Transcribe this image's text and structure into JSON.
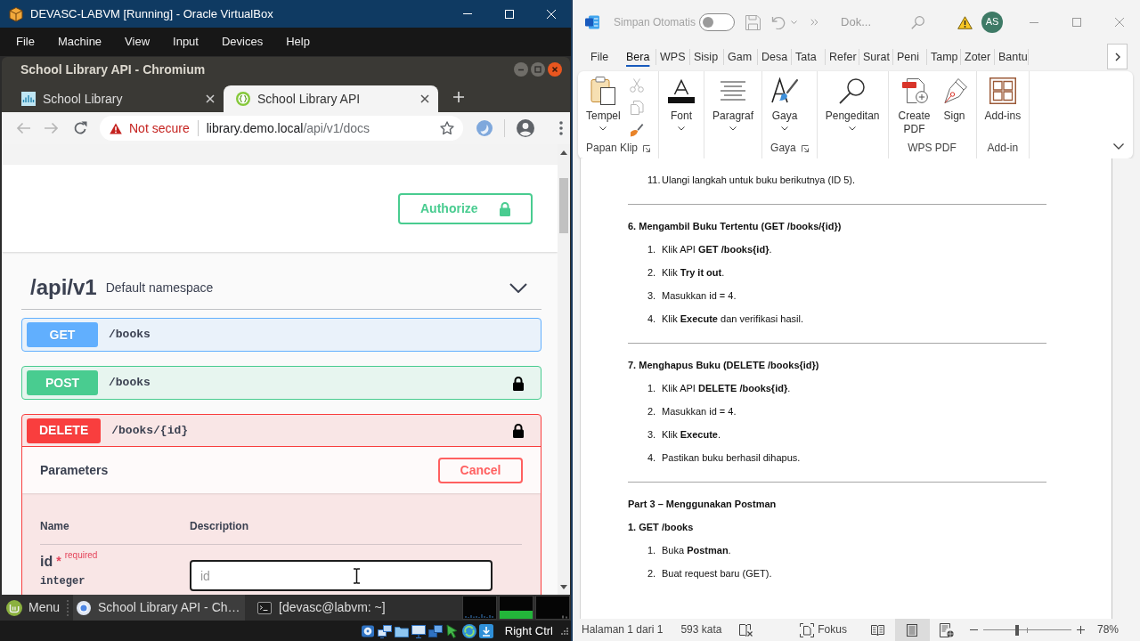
{
  "virtualbox": {
    "title": "DEVASC-LABVM [Running] - Oracle VirtualBox",
    "menu": [
      "File",
      "Machine",
      "View",
      "Input",
      "Devices",
      "Help"
    ],
    "browser": {
      "title": "School Library API - Chromium",
      "tabs": [
        {
          "label": "School Library",
          "selected": false
        },
        {
          "label": "School Library API",
          "selected": true
        }
      ],
      "address": {
        "security": "Not secure",
        "host": "library.demo.local",
        "path": "/api/v1/docs"
      },
      "swagger": {
        "authorize": "Authorize",
        "namespace": {
          "name": "/api/v1",
          "description": "Default namespace",
          "expanded": true
        },
        "operations": [
          {
            "method": "GET",
            "path": "/books",
            "color": "#61affe",
            "locked": false,
            "expanded": false
          },
          {
            "method": "POST",
            "path": "/books",
            "color": "#49cc90",
            "locked": true,
            "expanded": false
          },
          {
            "method": "DELETE",
            "path": "/books/{id}",
            "color": "#f93e3e",
            "locked": true,
            "expanded": true,
            "parameters": {
              "title": "Parameters",
              "cancel": "Cancel",
              "columns": [
                "Name",
                "Description"
              ],
              "rows": [
                {
                  "name": "id",
                  "required_mark": "*",
                  "required_text": "required",
                  "type": "integer",
                  "placeholder": "id"
                }
              ]
            }
          }
        ]
      }
    },
    "taskbar": {
      "menu": "Menu",
      "tasks": [
        {
          "kind": "browser",
          "label": "School Library API - Ch…",
          "selected": true
        },
        {
          "kind": "terminal",
          "label": "[devasc@labvm: ~]",
          "selected": false
        }
      ]
    },
    "status_bar": {
      "host_key": "Right Ctrl"
    }
  },
  "word": {
    "autosave": {
      "label": "Simpan Otomatis",
      "on": false
    },
    "doc_title": "Dok...",
    "user_initials": "AS",
    "tabs": [
      {
        "label": "File",
        "selected": false
      },
      {
        "label": "Bera",
        "selected": true
      },
      {
        "label": "WPS",
        "selected": false
      },
      {
        "label": "Sisip",
        "selected": false
      },
      {
        "label": "Gam",
        "selected": false
      },
      {
        "label": "Desa",
        "selected": false
      },
      {
        "label": "Tata",
        "selected": false
      },
      {
        "label": "Refer",
        "selected": false
      },
      {
        "label": "Surat",
        "selected": false
      },
      {
        "label": "Peni",
        "selected": false
      },
      {
        "label": "Tamp",
        "selected": false
      },
      {
        "label": "Zoter",
        "selected": false
      },
      {
        "label": "Bantu",
        "selected": false
      }
    ],
    "ribbon_groups": [
      {
        "label": "Papan Klip",
        "launcher": true,
        "commands": [
          {
            "kind": "paste",
            "label": "Tempel",
            "dropdown": true
          },
          {
            "kind": "cut",
            "disabled": true
          },
          {
            "kind": "copy",
            "disabled": true
          },
          {
            "kind": "format_painter",
            "disabled": false
          }
        ]
      },
      {
        "commands": [
          {
            "kind": "font",
            "label": "Font",
            "dropdown": true
          }
        ]
      },
      {
        "commands": [
          {
            "kind": "paragraph",
            "label": "Paragraf",
            "dropdown": true
          }
        ]
      },
      {
        "label": "Gaya",
        "launcher": true,
        "commands": [
          {
            "kind": "styles",
            "label": "Gaya",
            "dropdown": true
          }
        ]
      },
      {
        "commands": [
          {
            "kind": "editing",
            "label": "Pengeditan",
            "dropdown": true
          }
        ]
      },
      {
        "label": "WPS PDF",
        "commands": [
          {
            "kind": "create_pdf",
            "label": "Create PDF",
            "dropdown": false
          },
          {
            "kind": "sign",
            "label": "Sign",
            "dropdown": false
          }
        ]
      },
      {
        "label": "Add-in",
        "commands": [
          {
            "kind": "addins",
            "label": "Add-ins",
            "dropdown": false
          }
        ]
      }
    ],
    "document": [
      {
        "kind": "list_item",
        "number": "11.",
        "text": "Ulangi langkah untuk buku berikutnya (ID 5)."
      },
      {
        "kind": "rule"
      },
      {
        "kind": "heading",
        "text": "6. Mengambil Buku Tertentu (GET /books/{id})"
      },
      {
        "kind": "list_item",
        "number": "1.",
        "text": "Klik API **GET /books{id}**."
      },
      {
        "kind": "list_item",
        "number": "2.",
        "text": "Klik **Try it out**."
      },
      {
        "kind": "list_item",
        "number": "3.",
        "text": "Masukkan id = 4."
      },
      {
        "kind": "list_item",
        "number": "4.",
        "text": "Klik **Execute** dan verifikasi hasil."
      },
      {
        "kind": "rule"
      },
      {
        "kind": "heading",
        "text": "7. Menghapus Buku (DELETE /books{id})"
      },
      {
        "kind": "list_item",
        "number": "1.",
        "text": "Klik API **DELETE /books{id}**."
      },
      {
        "kind": "list_item",
        "number": "2.",
        "text": "Masukkan id = 4."
      },
      {
        "kind": "list_item",
        "number": "3.",
        "text": "Klik **Execute**."
      },
      {
        "kind": "list_item",
        "number": "4.",
        "text": "Pastikan buku berhasil dihapus."
      },
      {
        "kind": "rule"
      },
      {
        "kind": "heading",
        "text": "Part 3 – Menggunakan Postman"
      },
      {
        "kind": "heading",
        "text": "1. GET /books"
      },
      {
        "kind": "list_item",
        "number": "1.",
        "text": "Buka **Postman**."
      },
      {
        "kind": "list_item",
        "number": "2.",
        "text": "Buat request baru (GET)."
      }
    ],
    "status_bar": {
      "page": "Halaman 1 dari 1",
      "words": "593 kata",
      "focus": "Fokus",
      "views": [
        {
          "kind": "read",
          "selected": false
        },
        {
          "kind": "print",
          "selected": true
        },
        {
          "kind": "web",
          "selected": false
        }
      ],
      "zoom": {
        "level": 0.38,
        "reading": "78%"
      }
    }
  }
}
